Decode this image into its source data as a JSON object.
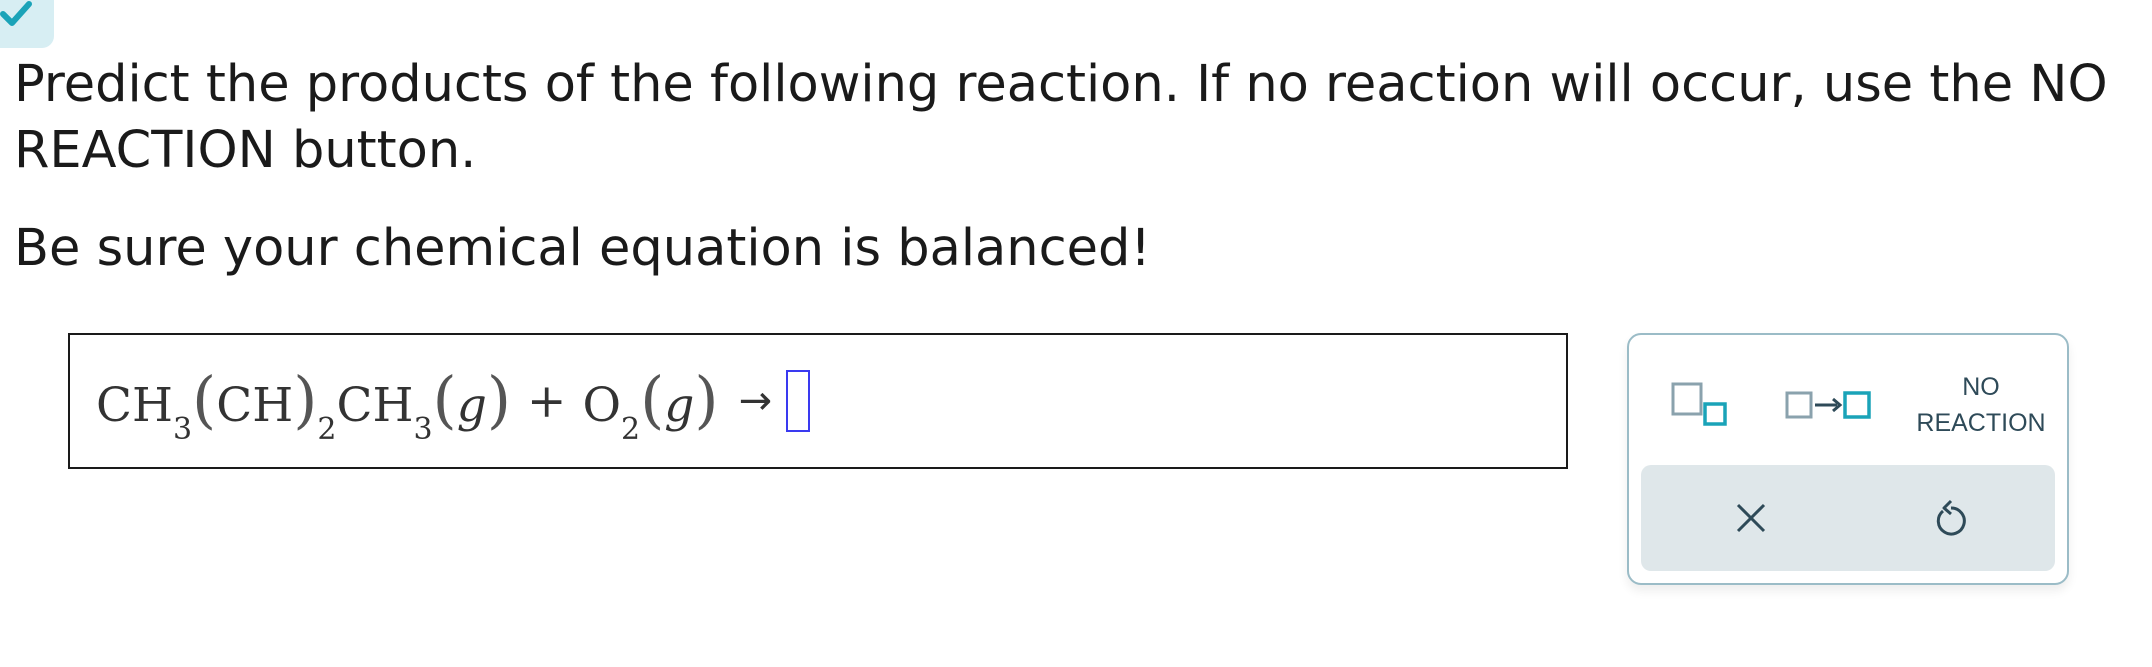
{
  "question": {
    "prompt": "Predict the products of the following reaction. If no reaction will occur, use the NO REACTION button.",
    "note": "Be sure your chemical equation is balanced!"
  },
  "equation": {
    "r1_a": "CH",
    "r1_a_sub": "3",
    "r1_b": "CH",
    "r1_b_sub": "2",
    "r1_c": "CH",
    "r1_c_sub": "3",
    "r1_state": "g",
    "plus": "+",
    "r2": "O",
    "r2_sub": "2",
    "r2_state": "g",
    "arrow": "→"
  },
  "palette": {
    "no_reaction_line1": "NO",
    "no_reaction_line2": "REACTION",
    "icons": [
      "subscript-template-icon",
      "reaction-arrow-template-icon",
      "close-icon",
      "undo-icon"
    ]
  },
  "colors": {
    "accent": "#1aa3b8",
    "icon_gray": "#8aa2ad",
    "cursor": "#3a3af0",
    "tab_bg": "#d7eef3"
  }
}
